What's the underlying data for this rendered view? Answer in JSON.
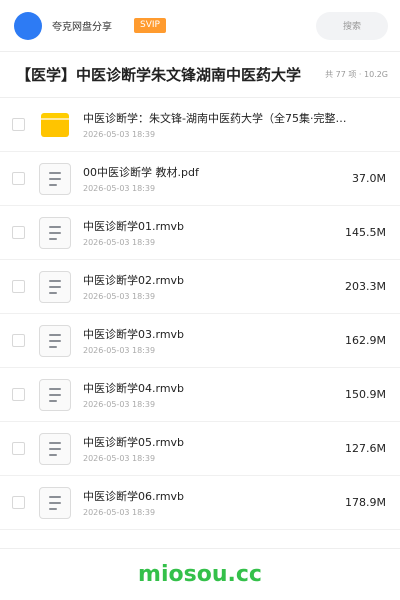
{
  "header": {
    "brand": "夸克网盘分享",
    "badge": "SVIP",
    "search_placeholder": "搜索"
  },
  "share": {
    "title": "【医学】中医诊断学朱文锋湖南中医药大学",
    "meta": "共 77 项 · 10.2G"
  },
  "files": [
    {
      "type": "folder",
      "name": "中医诊断学：朱文锋-湖南中医药大学（全75集·完整…",
      "date": "2026-05-03 18:39",
      "size": ""
    },
    {
      "type": "document",
      "name": "00中医诊断学 教材.pdf",
      "date": "2026-05-03 18:39",
      "size": "37.0M"
    },
    {
      "type": "document",
      "name": "中医诊断学01.rmvb",
      "date": "2026-05-03 18:39",
      "size": "145.5M"
    },
    {
      "type": "document",
      "name": "中医诊断学02.rmvb",
      "date": "2026-05-03 18:39",
      "size": "203.3M"
    },
    {
      "type": "document",
      "name": "中医诊断学03.rmvb",
      "date": "2026-05-03 18:39",
      "size": "162.9M"
    },
    {
      "type": "document",
      "name": "中医诊断学04.rmvb",
      "date": "2026-05-03 18:39",
      "size": "150.9M"
    },
    {
      "type": "document",
      "name": "中医诊断学05.rmvb",
      "date": "2026-05-03 18:39",
      "size": "127.6M"
    },
    {
      "type": "document",
      "name": "中医诊断学06.rmvb",
      "date": "2026-05-03 18:39",
      "size": "178.9M"
    }
  ],
  "footer": {
    "brand": "miosou.cc"
  },
  "colors": {
    "avatar": "#2d7bf4",
    "badge": "#ff9b2f",
    "folder": "#ffc400",
    "footer_brand": "#34c04a"
  }
}
